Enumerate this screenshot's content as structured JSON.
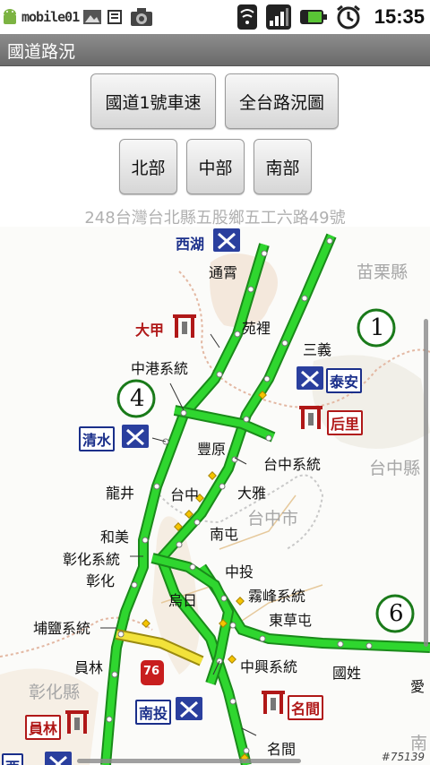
{
  "status_bar": {
    "app_logo_text": "mobile01",
    "time": "15:35",
    "icons": [
      "android-icon",
      "image-icon",
      "battery-cycle-icon",
      "camera-icon",
      "wifi-icon",
      "signal-icon",
      "battery-icon",
      "alarm-icon"
    ]
  },
  "title_bar": {
    "title": "國道路況"
  },
  "buttons": {
    "freeway1_speed": "國道1號車速",
    "island_map": "全台路況圖",
    "north": "北部",
    "central": "中部",
    "south": "南部"
  },
  "address": "248台灣台北縣五股鄉五工六路49號",
  "map": {
    "counties": {
      "miaoli": "苗栗縣",
      "taichung_county": "台中縣",
      "taichung_city": "台中市",
      "changhua": "彰化縣",
      "nantou": "南"
    },
    "places": {
      "tongxiao": "通霄",
      "yuanli": "苑裡",
      "sanyi": "三義",
      "zhonggang_jct": "中港系統",
      "fengyuan": "豐原",
      "taichung_jct": "台中系統",
      "longjing": "龍井",
      "taichung": "台中",
      "daya": "大雅",
      "nantun": "南屯",
      "hemei": "和美",
      "changhua_jct": "彰化系統",
      "changhua": "彰化",
      "zhongtou": "中投",
      "wuri": "烏日",
      "wufeng_jct": "霧峰系統",
      "caotun_east": "東草屯",
      "puyan_jct": "埔鹽系統",
      "yuanlin": "員林",
      "zhongxing_jct": "中興系統",
      "guoxing": "國姓",
      "mingjian": "名間",
      "ai": "愛"
    },
    "service_areas": {
      "xihu": "西湖",
      "taian": "泰安",
      "qingshui": "清水",
      "nantou": "南投",
      "xizhou": "西"
    },
    "toll_stations": {
      "dajia": "大甲",
      "houli": "后里",
      "mingjian": "名間",
      "yuanlin": "員林"
    },
    "route_shields": [
      "1",
      "4",
      "6",
      "76"
    ],
    "watermark": "#75139",
    "colors": {
      "freeway_green": "#2fd62f",
      "slow_yellow": "#f2e23a",
      "toll_red": "#b01818",
      "service_blue": "#1a2f8a"
    }
  }
}
